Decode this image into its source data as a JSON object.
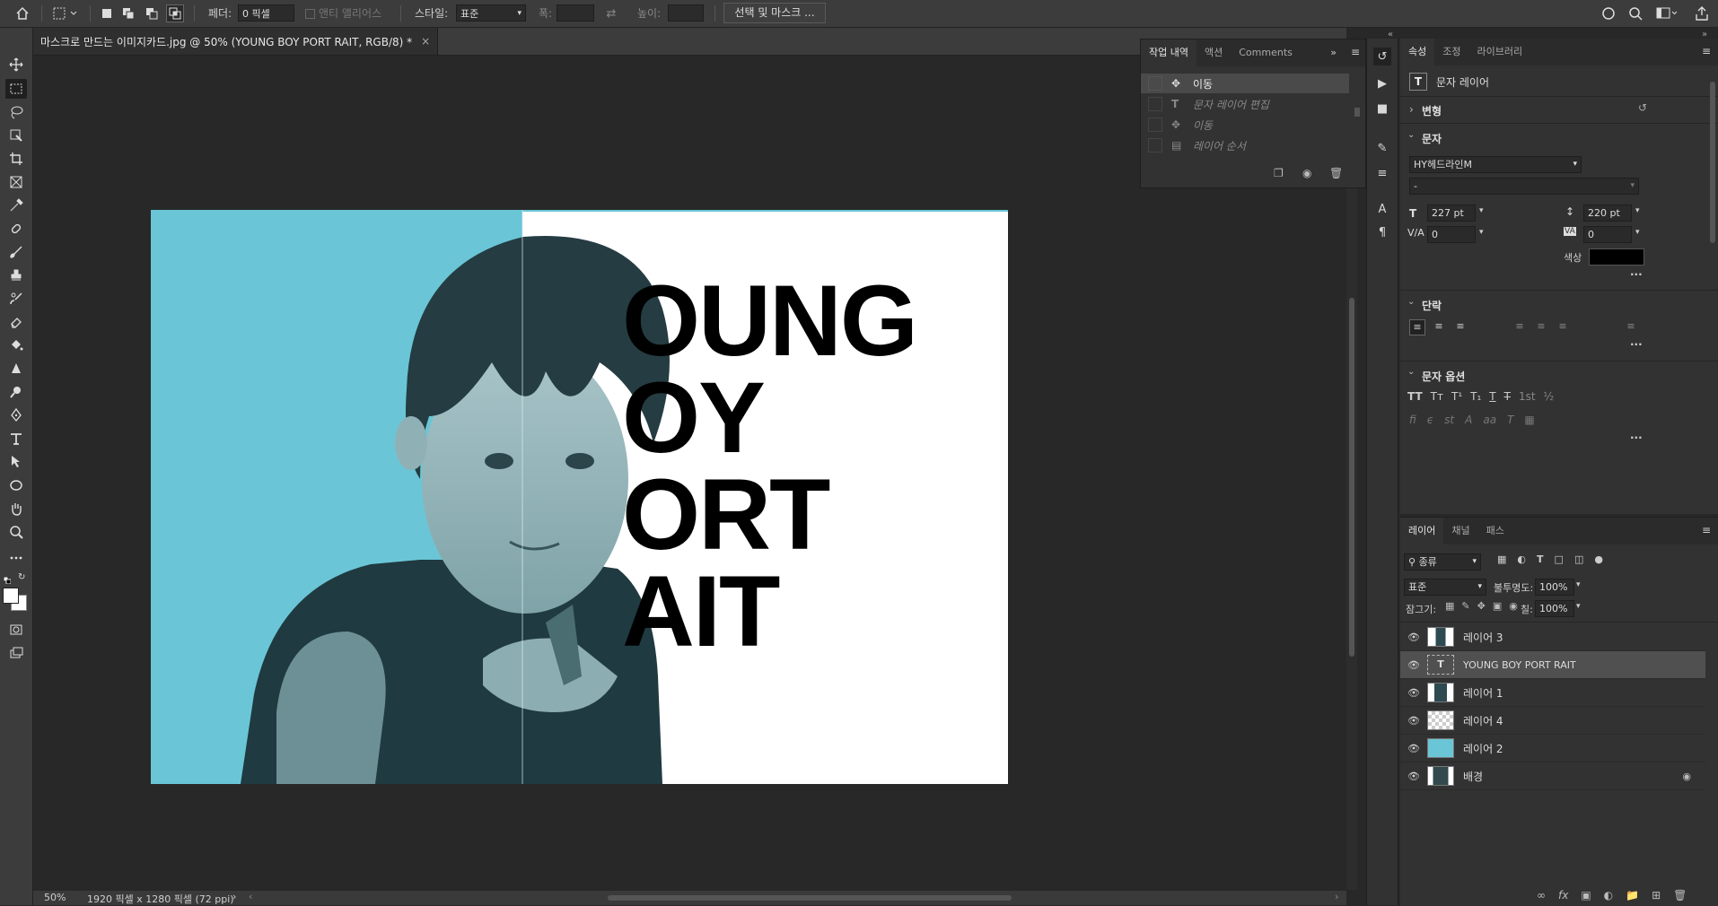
{
  "options_bar": {
    "feather_label": "페더:",
    "feather_value": "0 픽셀",
    "antialias_label": "앤티 앨리어스",
    "style_label": "스타일:",
    "style_value": "표준",
    "width_label": "폭:",
    "height_label": "높이:",
    "select_mask_button": "선택 및 마스크 ..."
  },
  "document": {
    "tab_title": "마스크로 만드는 이미지카드.jpg @ 50% (YOUNG BOY PORT RAIT, RGB/8) *",
    "text_lines": [
      "OUNG",
      "OY",
      "ORT",
      "AIT"
    ],
    "bg_color": "#6ac6d6"
  },
  "status": {
    "zoom": "50%",
    "doc_size": "1920 픽셀 x 1280 픽셀 (72 ppi)"
  },
  "history_panel": {
    "tabs": [
      "작업 내역",
      "액션",
      "Comments"
    ],
    "items": [
      {
        "label": "이동",
        "icon": "move-icon"
      },
      {
        "label": "문자 레이어 편집",
        "icon": "type-icon"
      },
      {
        "label": "이동",
        "icon": "move-icon"
      },
      {
        "label": "레이어 순서",
        "icon": "layer-order-icon"
      }
    ]
  },
  "properties_panel": {
    "tabs": [
      "속성",
      "조정",
      "라이브러리"
    ],
    "layer_kind": "문자 레이어",
    "transform_label": "변형",
    "character_label": "문자",
    "font_family": "HY헤드라인M",
    "font_style": "-",
    "font_size": "227 pt",
    "leading": "220 pt",
    "kerning": "0",
    "tracking": "0",
    "color_label": "색상",
    "text_color": "#000000",
    "paragraph_label": "단락",
    "character_options_label": "문자 옵션",
    "more_glyph": "···"
  },
  "layers_panel": {
    "tabs": [
      "레이어",
      "채널",
      "패스"
    ],
    "filter_kind": "종류",
    "blend_mode": "표준",
    "opacity_label": "불투명도:",
    "opacity_value": "100%",
    "lock_label": "잠그기:",
    "fill_label": "칠:",
    "fill_value": "100%",
    "layers": [
      {
        "name": "레이어 3",
        "type": "image-mask"
      },
      {
        "name": "YOUNG BOY PORT RAIT",
        "type": "text",
        "selected": true
      },
      {
        "name": "레이어 1",
        "type": "image"
      },
      {
        "name": "레이어 4",
        "type": "empty"
      },
      {
        "name": "레이어 2",
        "type": "fill",
        "color": "#6ac6d6"
      },
      {
        "name": "배경",
        "type": "background",
        "locked": true
      }
    ]
  }
}
